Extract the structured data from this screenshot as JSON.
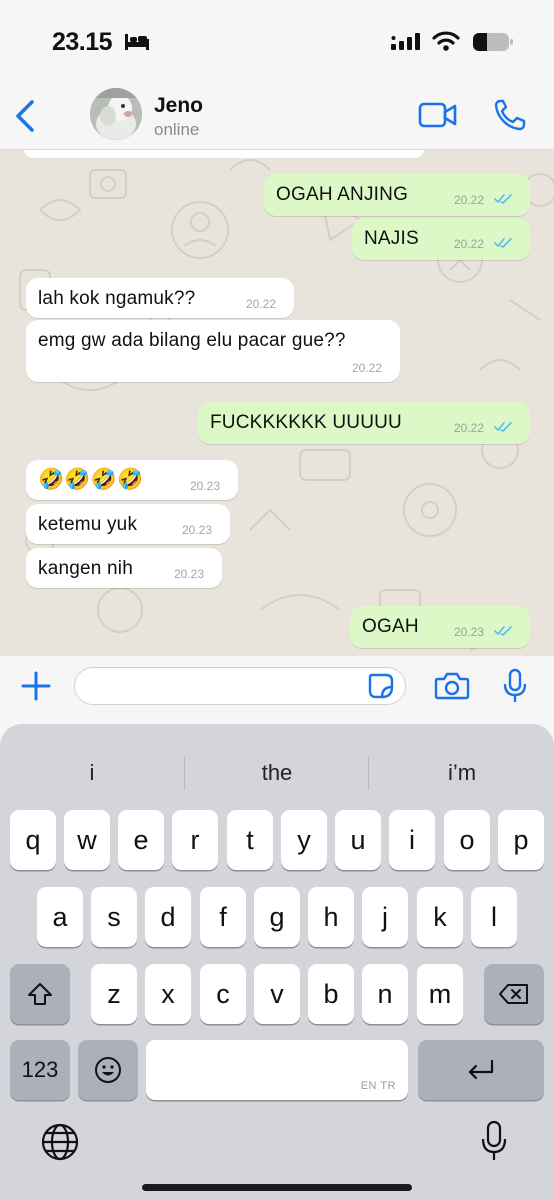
{
  "status_bar": {
    "time": "23.15",
    "icons": [
      "bed-icon",
      "signal-icon",
      "wifi-icon",
      "battery-icon"
    ]
  },
  "header": {
    "back_icon": "chevron-left-icon",
    "contact_name": "Jeno",
    "contact_status": "online",
    "video_icon": "video-camera-icon",
    "call_icon": "phone-icon",
    "accent_color": "#1a73e8"
  },
  "messages": [
    {
      "direction": "out",
      "text": "OGAH ANJING",
      "time": "20.22",
      "status": "read"
    },
    {
      "direction": "out",
      "text": "NAJIS",
      "time": "20.22",
      "status": "read"
    },
    {
      "direction": "in",
      "text": "lah kok ngamuk??",
      "time": "20.22"
    },
    {
      "direction": "in",
      "text": "emg gw ada bilang elu pacar gue??",
      "time": "20.22"
    },
    {
      "direction": "out",
      "text": "FUCKKKKKK UUUUU",
      "time": "20.22",
      "status": "read"
    },
    {
      "direction": "in",
      "text": "🤣🤣🤣🤣",
      "time": "20.23"
    },
    {
      "direction": "in",
      "text": "ketemu yuk",
      "time": "20.23"
    },
    {
      "direction": "in",
      "text": "kangen nih",
      "time": "20.23"
    },
    {
      "direction": "out",
      "text": "OGAH",
      "time": "20.23",
      "status": "read"
    }
  ],
  "input_bar": {
    "placeholder": "",
    "value": "",
    "icons": [
      "plus-icon",
      "sticker-icon",
      "camera-icon",
      "microphone-icon"
    ]
  },
  "keyboard": {
    "suggestions": [
      "i",
      "the",
      "i’m"
    ],
    "row1": [
      "q",
      "w",
      "e",
      "r",
      "t",
      "y",
      "u",
      "i",
      "o",
      "p"
    ],
    "row2": [
      "a",
      "s",
      "d",
      "f",
      "g",
      "h",
      "j",
      "k",
      "l"
    ],
    "row3": [
      "z",
      "x",
      "c",
      "v",
      "b",
      "n",
      "m"
    ],
    "numbers_key": "123",
    "space_label": "EN TR"
  },
  "colors": {
    "outgoing_bubble": "#dcf8c6",
    "incoming_bubble": "#ffffff",
    "chat_background": "#e9e4db",
    "read_tick": "#53bdeb"
  }
}
